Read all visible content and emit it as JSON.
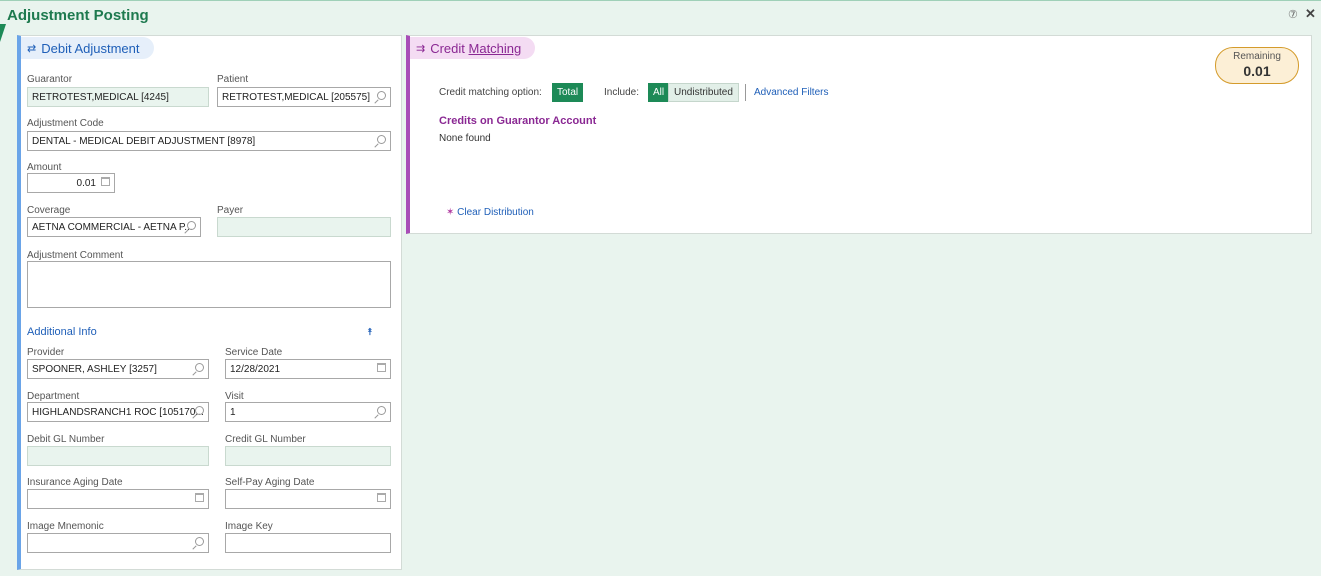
{
  "window": {
    "title": "Adjustment Posting",
    "help_glyph": "⑦",
    "close_glyph": "✕"
  },
  "debit": {
    "header": "Debit Adjustment",
    "guarantor_label": "Guarantor",
    "guarantor_value": "RETROTEST,MEDICAL [4245]",
    "patient_label": "Patient",
    "patient_value": "RETROTEST,MEDICAL [205575]",
    "adjustment_code_label": "Adjustment Code",
    "adjustment_code_value": "DENTAL - MEDICAL DEBIT ADJUSTMENT [8978]",
    "amount_label": "Amount",
    "amount_value": "0.01",
    "coverage_label": "Coverage",
    "coverage_value": "AETNA COMMERCIAL - AETNA P...",
    "payer_label": "Payer",
    "payer_value": "",
    "comment_label": "Adjustment Comment",
    "comment_value": "",
    "additional_info_label": "Additional Info",
    "provider_label": "Provider",
    "provider_value": "SPOONER, ASHLEY [3257]",
    "service_date_label": "Service Date",
    "service_date_value": "12/28/2021",
    "department_label": "Department",
    "department_value": "HIGHLANDSRANCH1 ROC [105170...",
    "visit_label": "Visit",
    "visit_value": "1",
    "debit_gl_label": "Debit GL Number",
    "debit_gl_value": "",
    "credit_gl_label": "Credit GL Number",
    "credit_gl_value": "",
    "insurance_aging_label": "Insurance Aging Date",
    "insurance_aging_value": "",
    "selfpay_aging_label": "Self-Pay Aging Date",
    "selfpay_aging_value": "",
    "image_mnemonic_label": "Image Mnemonic",
    "image_mnemonic_value": "",
    "image_key_label": "Image Key",
    "image_key_value": ""
  },
  "credit": {
    "header_prefix": "Credit ",
    "header_underlined": "Matching",
    "remaining_label": "Remaining",
    "remaining_value": "0.01",
    "option_label": "Credit matching option:",
    "option_value": "Total",
    "include_label": "Include:",
    "include_all": "All",
    "include_undistributed": "Undistributed",
    "advanced_filters": "Advanced Filters",
    "credits_heading": "Credits on Guarantor Account",
    "credits_status": "None found",
    "clear_distribution": "Clear Distribution"
  },
  "colors": {
    "accent_green": "#1d8a57",
    "debit_accent": "#1f5fb8",
    "credit_accent": "#8a2893"
  }
}
